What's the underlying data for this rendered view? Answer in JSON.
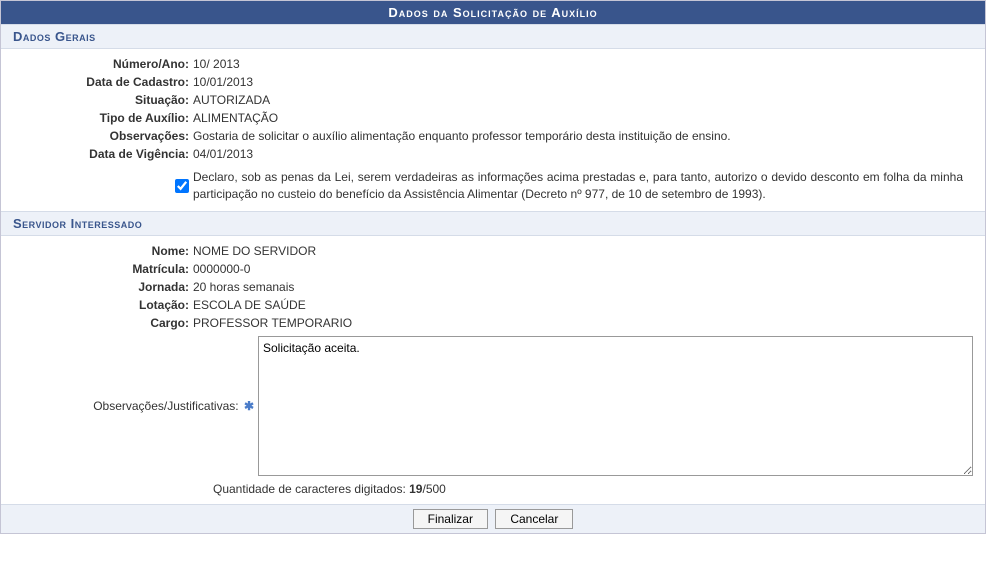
{
  "main_title": "Dados da Solicitação de Auxílio",
  "sections": {
    "dados_gerais": {
      "header": "Dados Gerais",
      "numero_ano_label": "Número/Ano:",
      "numero_ano_value": "10/ 2013",
      "data_cadastro_label": "Data de Cadastro:",
      "data_cadastro_value": "10/01/2013",
      "situacao_label": "Situação:",
      "situacao_value": "AUTORIZADA",
      "tipo_auxilio_label": "Tipo de Auxílio:",
      "tipo_auxilio_value": "ALIMENTAÇÃO",
      "observacoes_label": "Observações:",
      "observacoes_value": "Gostaria de solicitar o auxílio alimentação enquanto professor temporário desta instituição de ensino.",
      "data_vigencia_label": "Data de Vigência:",
      "data_vigencia_value": "04/01/2013",
      "declaration_text": "Declaro, sob as penas da Lei, serem verdadeiras as informações acima prestadas e, para tanto, autorizo o devido desconto em folha da minha participação no custeio do benefício da Assistência Alimentar (Decreto nº 977, de 10 de setembro de 1993)."
    },
    "servidor_interessado": {
      "header": "Servidor Interessado",
      "nome_label": "Nome:",
      "nome_value": "NOME DO SERVIDOR",
      "matricula_label": "Matrícula:",
      "matricula_value": "0000000-0",
      "jornada_label": "Jornada:",
      "jornada_value": "20 horas semanais",
      "lotacao_label": "Lotação:",
      "lotacao_value": "ESCOLA DE SAÚDE",
      "cargo_label": "Cargo:",
      "cargo_value": "PROFESSOR TEMPORARIO",
      "obs_just_label": "Observações/Justificativas:",
      "obs_just_value": "Solicitação aceita.",
      "char_count_prefix": "Quantidade de caracteres digitados: ",
      "char_count_current": "19",
      "char_count_max": "/500"
    }
  },
  "buttons": {
    "finalizar": "Finalizar",
    "cancelar": "Cancelar"
  }
}
